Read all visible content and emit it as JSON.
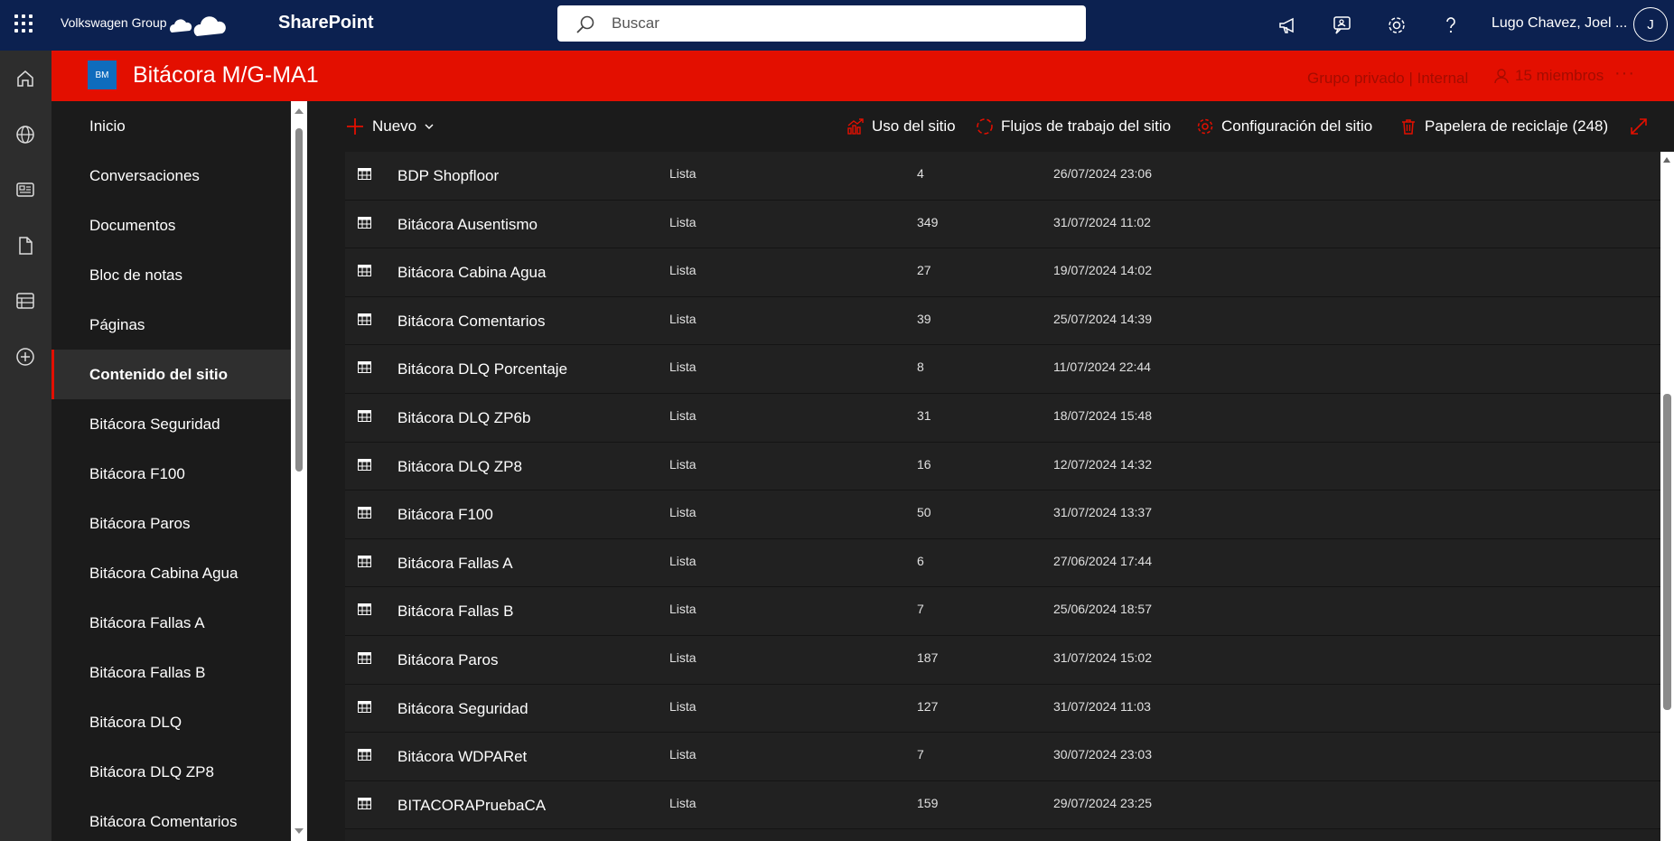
{
  "suite_bar": {
    "org": "Volkswagen Group",
    "app": "SharePoint",
    "search_placeholder": "Buscar",
    "user": "Lugo Chavez, Joel ...",
    "avatar_initial": "J"
  },
  "site": {
    "logo": "BM",
    "title": "Bitácora M/G-MA1",
    "privacy": "Grupo privado | Internal",
    "members": "15 miembros",
    "more": "···",
    "accent": "#e30f00"
  },
  "nav": {
    "items": [
      {
        "label": "Inicio"
      },
      {
        "label": "Conversaciones"
      },
      {
        "label": "Documentos"
      },
      {
        "label": "Bloc de notas"
      },
      {
        "label": "Páginas"
      },
      {
        "label": "Contenido del sitio"
      },
      {
        "label": "Bitácora Seguridad"
      },
      {
        "label": "Bitácora F100"
      },
      {
        "label": "Bitácora Paros"
      },
      {
        "label": "Bitácora Cabina Agua"
      },
      {
        "label": "Bitácora Fallas A"
      },
      {
        "label": "Bitácora Fallas B"
      },
      {
        "label": "Bitácora DLQ"
      },
      {
        "label": "Bitácora DLQ ZP8"
      },
      {
        "label": "Bitácora Comentarios"
      }
    ],
    "active_index": 5
  },
  "commands": {
    "new": "Nuevo",
    "usage": "Uso del sitio",
    "workflows": "Flujos de trabajo del sitio",
    "settings": "Configuración del sitio",
    "recycle": "Papelera de reciclaje (248)"
  },
  "rows": [
    {
      "name": "BDP Shopfloor",
      "type": "Lista",
      "items": "4",
      "modified": "26/07/2024 23:06"
    },
    {
      "name": "Bitácora Ausentismo",
      "type": "Lista",
      "items": "349",
      "modified": "31/07/2024 11:02"
    },
    {
      "name": "Bitácora Cabina Agua",
      "type": "Lista",
      "items": "27",
      "modified": "19/07/2024 14:02"
    },
    {
      "name": "Bitácora Comentarios",
      "type": "Lista",
      "items": "39",
      "modified": "25/07/2024 14:39"
    },
    {
      "name": "Bitácora DLQ Porcentaje",
      "type": "Lista",
      "items": "8",
      "modified": "11/07/2024 22:44"
    },
    {
      "name": "Bitácora DLQ ZP6b",
      "type": "Lista",
      "items": "31",
      "modified": "18/07/2024 15:48"
    },
    {
      "name": "Bitácora DLQ ZP8",
      "type": "Lista",
      "items": "16",
      "modified": "12/07/2024 14:32"
    },
    {
      "name": "Bitácora F100",
      "type": "Lista",
      "items": "50",
      "modified": "31/07/2024 13:37"
    },
    {
      "name": "Bitácora Fallas A",
      "type": "Lista",
      "items": "6",
      "modified": "27/06/2024 17:44"
    },
    {
      "name": "Bitácora Fallas B",
      "type": "Lista",
      "items": "7",
      "modified": "25/06/2024 18:57"
    },
    {
      "name": "Bitácora Paros",
      "type": "Lista",
      "items": "187",
      "modified": "31/07/2024 15:02"
    },
    {
      "name": "Bitácora Seguridad",
      "type": "Lista",
      "items": "127",
      "modified": "31/07/2024 11:03"
    },
    {
      "name": "Bitácora WDPARet",
      "type": "Lista",
      "items": "7",
      "modified": "30/07/2024 23:03"
    },
    {
      "name": "BITACORAPruebaCA",
      "type": "Lista",
      "items": "159",
      "modified": "29/07/2024 23:25"
    }
  ]
}
